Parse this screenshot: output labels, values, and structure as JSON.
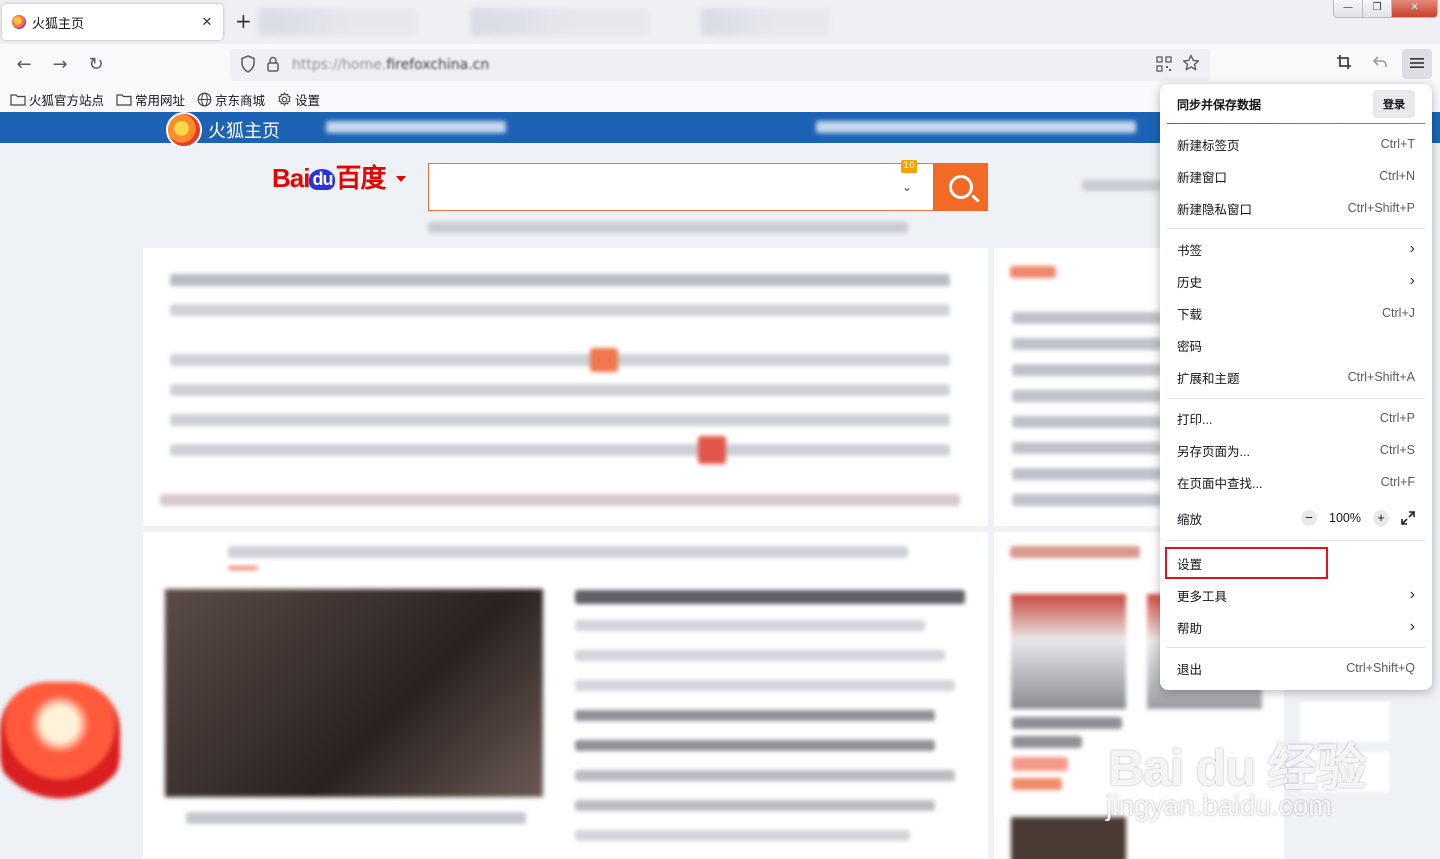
{
  "tab": {
    "title": "火狐主页",
    "close": "✕",
    "new_tab": "+"
  },
  "window_controls": {
    "minimize": "—",
    "maximize": "❐",
    "close": "✕"
  },
  "navbar": {
    "back": "←",
    "forward": "→",
    "reload": "↻",
    "url_prefix": "https://home.",
    "url_domain": "firefoxchina.cn"
  },
  "bookmarks": [
    {
      "label": "火狐官方站点",
      "icon": "folder-icon"
    },
    {
      "label": "常用网址",
      "icon": "folder-icon"
    },
    {
      "label": "京东商城",
      "icon": "globe-icon"
    },
    {
      "label": "设置",
      "icon": "gear-icon"
    }
  ],
  "page": {
    "header_title": "火狐主页",
    "baidu_logo_a": "Bai",
    "baidu_logo_du": "du",
    "baidu_logo_b": "百度",
    "search_badge": "10"
  },
  "menu": {
    "sync": {
      "label": "同步并保存数据",
      "login": "登录"
    },
    "items": [
      {
        "label": "新建标签页",
        "shortcut": "Ctrl+T"
      },
      {
        "label": "新建窗口",
        "shortcut": "Ctrl+N"
      },
      {
        "label": "新建隐私窗口",
        "shortcut": "Ctrl+Shift+P"
      },
      {
        "label": "书签",
        "shortcut": ""
      },
      {
        "label": "历史",
        "shortcut": ""
      },
      {
        "label": "下载",
        "shortcut": "Ctrl+J"
      },
      {
        "label": "密码",
        "shortcut": ""
      },
      {
        "label": "扩展和主题",
        "shortcut": "Ctrl+Shift+A"
      },
      {
        "label": "打印...",
        "shortcut": "Ctrl+P"
      },
      {
        "label": "另存页面为...",
        "shortcut": "Ctrl+S"
      },
      {
        "label": "在页面中查找...",
        "shortcut": "Ctrl+F"
      },
      {
        "label": "设置",
        "shortcut": ""
      },
      {
        "label": "更多工具",
        "shortcut": ""
      },
      {
        "label": "帮助",
        "shortcut": ""
      },
      {
        "label": "退出",
        "shortcut": "Ctrl+Shift+Q"
      }
    ],
    "zoom": {
      "label": "缩放",
      "minus": "−",
      "value": "100%",
      "plus": "+"
    }
  },
  "watermark": {
    "brand": "Bai du 经验",
    "url": "jingyan.baidu.com"
  },
  "colors": {
    "accent": "#1d63b5",
    "search_orange": "#f26a25",
    "highlight": "#e8111b"
  }
}
